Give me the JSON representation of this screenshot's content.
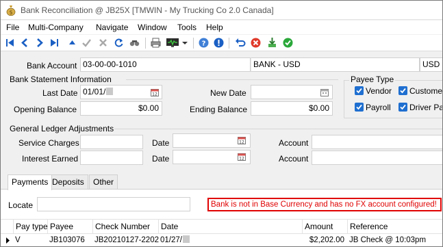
{
  "window": {
    "title": "Bank Reconciliation @ JB25X [TMWIN - My Trucking Co 2.0 Canada]"
  },
  "menu": [
    "File",
    "Multi-Company",
    "Navigate",
    "Window",
    "Tools",
    "Help"
  ],
  "toolbar_icons": [
    "first-record-icon",
    "previous-record-icon",
    "next-record-icon",
    "last-record-icon",
    "up-arrow-icon",
    "save-checkmark-icon",
    "delete-x-icon",
    "refresh-icon",
    "binoculars-icon",
    "print-icon",
    "monitor-icon",
    "dropdown-icon",
    "help-icon",
    "info-icon",
    "undo-icon",
    "cancel-icon",
    "import-icon",
    "approve-icon"
  ],
  "colors": {
    "accent_blue": "#1f6fd0",
    "error_red": "#e00000"
  },
  "bank": {
    "label": "Bank Account",
    "account": "03-00-00-1010",
    "name": "BANK - USD",
    "currency": "USD"
  },
  "statement": {
    "section": "Bank Statement Information",
    "last_date_label": "Last Date",
    "last_date": "01/01/",
    "new_date_label": "New Date",
    "new_date": "",
    "opening_label": "Opening Balance",
    "opening": "$0.00",
    "ending_label": "Ending Balance",
    "ending": "$0.00"
  },
  "payee": {
    "title": "Payee Type",
    "items": [
      {
        "label": "Vendor",
        "checked": true
      },
      {
        "label": "Custome",
        "checked": true
      },
      {
        "label": "Payroll",
        "checked": true
      },
      {
        "label": "Driver Pa",
        "checked": true
      }
    ]
  },
  "gl": {
    "section": "General Ledger Adjustments",
    "service_label": "Service Charges",
    "service_value": "",
    "interest_label": "Interest Earned",
    "interest_value": "",
    "date_label": "Date",
    "account_label": "Account"
  },
  "tabs": [
    "Payments",
    "Deposits",
    "Other"
  ],
  "locate": {
    "label": "Locate",
    "value": ""
  },
  "alert": "Bank is not in Base Currency and has no FX account configured!",
  "table": {
    "columns": [
      "Pay type",
      "Payee",
      "Check Number",
      "Date",
      "Amount",
      "Reference"
    ],
    "rows": [
      {
        "pay_type": "V",
        "payee": "JB103076",
        "check_number": "JB20210127-2202",
        "date": "01/27/",
        "amount": "$2,202.00",
        "reference": "JB Check @ 10:03pm"
      }
    ]
  }
}
